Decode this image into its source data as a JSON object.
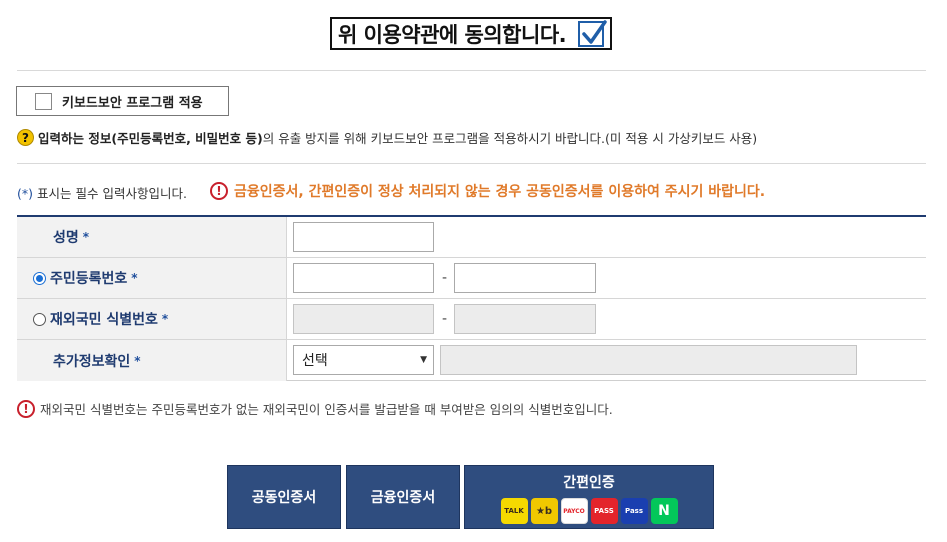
{
  "agree": {
    "label": "위 이용약관에 동의합니다.",
    "checked": true
  },
  "keyboard_security": {
    "label": "키보드보안 프로그램 적용",
    "checked": false
  },
  "notice": {
    "icon": "question-icon",
    "bold": "입력하는 정보(주민등록번호, 비밀번호 등)",
    "rest": "의 유출 방지를 위해 키보드보안 프로그램을 적용하시기 바랍니다.(미 적용 시 가상키보드 사용)"
  },
  "required_note": {
    "star": "(*)",
    "text": "표시는 필수 입력사항입니다."
  },
  "warning_note": "금융인증서, 간편인증이 정상 처리되지 않는 경우 공동인증서를 이용하여 주시기 바랍니다.",
  "form": {
    "name_label": "성명",
    "rrn_label": "주민등록번호",
    "foreign_label": "재외국민 식별번호",
    "extra_label": "추가정보확인",
    "required_mark": "*",
    "separator": "-",
    "id_type_selected": "rrn",
    "extra_select_value": "선택"
  },
  "bottom_note": "재외국민 식별번호는 주민등록번호가 없는 재외국민이 인증서를 발급받을 때 부여받은 임의의 식별번호입니다.",
  "buttons": {
    "joint_cert": "공동인증서",
    "financial_cert": "금융인증서",
    "easy_auth": "간편인증",
    "easy_logos": [
      {
        "name": "kakao-logo",
        "text": "TALK"
      },
      {
        "name": "kb-logo",
        "text": "★b"
      },
      {
        "name": "payco-logo",
        "text": "PAYCO"
      },
      {
        "name": "pass-logo",
        "text": "PASS"
      },
      {
        "name": "samsung-pass-logo",
        "text": "Pass"
      },
      {
        "name": "naver-logo",
        "text": "N"
      }
    ]
  },
  "colors": {
    "primary_navy": "#2f4d7f",
    "warning_orange": "#e07a2a",
    "warning_red": "#c8202c",
    "required_star": "#1f4e9c"
  }
}
